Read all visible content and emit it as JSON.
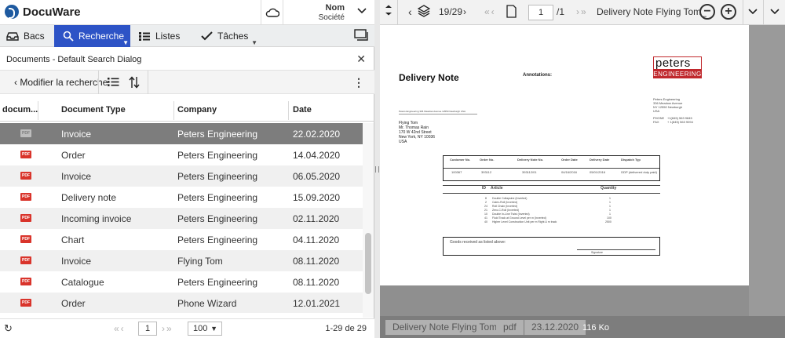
{
  "app": {
    "name": "DocuWare"
  },
  "user": {
    "name": "Nom",
    "company": "Société"
  },
  "tabs": [
    {
      "label": "Bacs"
    },
    {
      "label": "Recherche"
    },
    {
      "label": "Listes"
    },
    {
      "label": "Tâches"
    }
  ],
  "dialog": {
    "title": "Documents - Default Search Dialog",
    "back_label": "Modifier la recherche"
  },
  "table": {
    "columns": [
      "docum...",
      "Document Type",
      "Company",
      "Date"
    ],
    "rows": [
      {
        "type": "Invoice",
        "company": "Peters Engineering",
        "date": "22.02.2020"
      },
      {
        "type": "Order",
        "company": "Peters Engineering",
        "date": "14.04.2020"
      },
      {
        "type": "Invoice",
        "company": "Peters Engineering",
        "date": "06.05.2020"
      },
      {
        "type": "Delivery note",
        "company": "Peters Engineering",
        "date": "15.09.2020"
      },
      {
        "type": "Incoming invoice",
        "company": "Peters Engineering",
        "date": "02.11.2020"
      },
      {
        "type": "Chart",
        "company": "Peters Engineering",
        "date": "04.11.2020"
      },
      {
        "type": "Invoice",
        "company": "Flying Tom",
        "date": "08.11.2020"
      },
      {
        "type": "Catalogue",
        "company": "Peters Engineering",
        "date": "08.11.2020"
      },
      {
        "type": "Order",
        "company": "Phone Wizard",
        "date": "12.01.2021"
      }
    ],
    "file_badge": "PDF"
  },
  "footer": {
    "page": "1",
    "page_size": "100",
    "count": "1-29 de 29"
  },
  "viewer": {
    "doc_position": "19/29",
    "page_input": "1",
    "page_total": "/1",
    "doc_title": "Delivery Note Flying Tom_",
    "status_name": "Delivery Note Flying Tom_",
    "status_type": "pdf",
    "status_date": "23.12.2020",
    "status_size": "116 Ko"
  },
  "document": {
    "title": "Delivery Note",
    "annotations_label": "Annotations:",
    "logo_top": "peters",
    "logo_bottom": "ENGINEERING",
    "sender_line": "Peters Engineering 336 Meadow Avenue 12550 Newburgh USA",
    "recipient": [
      "Flying Tom",
      "Mr. Thomas Rain",
      "170 W 42nd Street",
      "New York, NY 10036",
      "USA"
    ],
    "company_address": [
      "Peters Engineering",
      "336 Meadow Avenue",
      "NY 12550 Newburgh",
      "USA"
    ],
    "phone_label": "PHONE",
    "phone": "+1(845) 563 9845",
    "fax_label": "FAX",
    "fax": "+ 1(845) 563 9094",
    "header_cols": [
      "Customer No.",
      "Order No.",
      "Delivery Note No.",
      "Order Date",
      "Delivery Date",
      "Dispatch Typ"
    ],
    "header_vals": [
      "100367",
      "393112",
      "393112/01",
      "04/16/2016",
      "05/01/2016",
      "DDP (delivered duty paid)"
    ],
    "items_cols": [
      "ID",
      "Article",
      "Quantity"
    ],
    "items": [
      {
        "id": "8",
        "article": "Double Collapsine (Inverted)",
        "qty": "1"
      },
      {
        "id": "2",
        "article": "Calex-Roll (Inverted)",
        "qty": "1"
      },
      {
        "id": "24",
        "article": "Roll Chain (Inverted)",
        "qty": "1"
      },
      {
        "id": "21",
        "article": "Zero-C-Roll (Inverted)",
        "qty": "1"
      },
      {
        "id": "10",
        "article": "Double In-Line Twist (Inverted)",
        "qty": "1"
      },
      {
        "id": "41",
        "article": "Fluid Track at Ground Level per m (Inverted)",
        "qty": "100"
      },
      {
        "id": "40",
        "article": "Higher Level Construction Unit per m Right & m track",
        "qty": "2500"
      }
    ],
    "goods_received": "Goods received as listed above:",
    "signature": "Signature"
  }
}
